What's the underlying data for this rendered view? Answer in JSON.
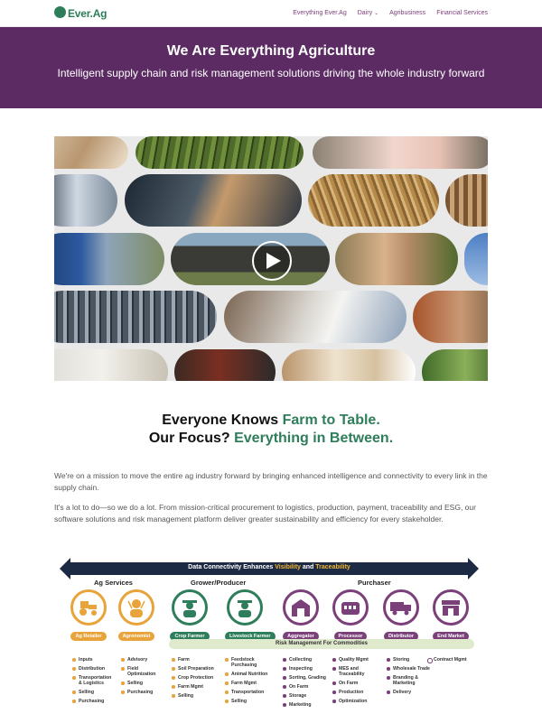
{
  "header": {
    "logo_text": "Ever.Ag",
    "nav": [
      {
        "label": "Everything Ever.Ag"
      },
      {
        "label": "Dairy",
        "has_dropdown": true
      },
      {
        "label": "Agribusiness"
      },
      {
        "label": "Financial Services"
      }
    ]
  },
  "hero": {
    "title": "We Are Everything Agriculture",
    "subtitle": "Intelligent supply chain and risk management solutions driving the whole industry forward"
  },
  "video": {
    "play_icon": "play-icon"
  },
  "tagline": {
    "line1_prefix": "Everyone Knows ",
    "line1_highlight": "Farm to Table.",
    "line2_prefix": "Our Focus? ",
    "line2_highlight": "Everything in Between."
  },
  "body": {
    "para1": "We're on a mission to move the entire ag industry forward by bringing enhanced intelligence and connectivity to every link in the supply chain.",
    "para2": "It's a lot to do—so we do a lot. From mission-critical procurement to logistics, production, payment, traceability and ESG, our software solutions and risk management platform deliver greater sustainability and efficiency for every stakeholder."
  },
  "diagram": {
    "arrow_label_prefix": "Data Connectivity Enhances ",
    "arrow_label_h1": "Visibility",
    "arrow_label_and": " and ",
    "arrow_label_h2": "Traceability",
    "groups": {
      "ag_services": "Ag Services",
      "grower": "Grower/Producer",
      "purchaser": "Purchaser"
    },
    "roles": {
      "ag_retailer": "Ag Retailer",
      "agronomist": "Agronomist",
      "crop_farmer": "Crop Farmer",
      "livestock_farmer": "Livestock Farmer",
      "aggregator": "Aggregator",
      "processor": "Processor",
      "distributor": "Distributor",
      "end_market": "End Market"
    },
    "risk_label": "Risk Management For Commodities",
    "colors": {
      "orange": "#e8a33a",
      "green": "#2e7d5b",
      "purple": "#7b3f7a",
      "navy": "#1d2a44"
    },
    "lists": {
      "c1": [
        "Inputs",
        "Distribution",
        "Transportation & Logistics",
        "Selling",
        "Purchasing"
      ],
      "c2": [
        "Advisory",
        "Field Optimization",
        "Selling",
        "Purchasing"
      ],
      "c3": [
        "Farm",
        "Soil Preparation",
        "Crop Protection",
        "Farm Mgmt",
        "Selling"
      ],
      "c4": [
        "Feedstock Purchasing",
        "Animal Nutrition",
        "Farm Mgmt",
        "Transportation",
        "Selling"
      ],
      "c5": [
        "Collecting",
        "Inspecting",
        "Sorting, Grading",
        "On Farm",
        "Storage",
        "Marketing"
      ],
      "c6": [
        "Quality Mgmt",
        "MES and Traceability",
        "On Farm",
        "Production",
        "Optimization"
      ],
      "c7": [
        "Storing",
        "Wholesale Trade",
        "Branding & Marketing",
        "Delivery"
      ],
      "c8": [
        "Contract Mgmt"
      ]
    }
  }
}
